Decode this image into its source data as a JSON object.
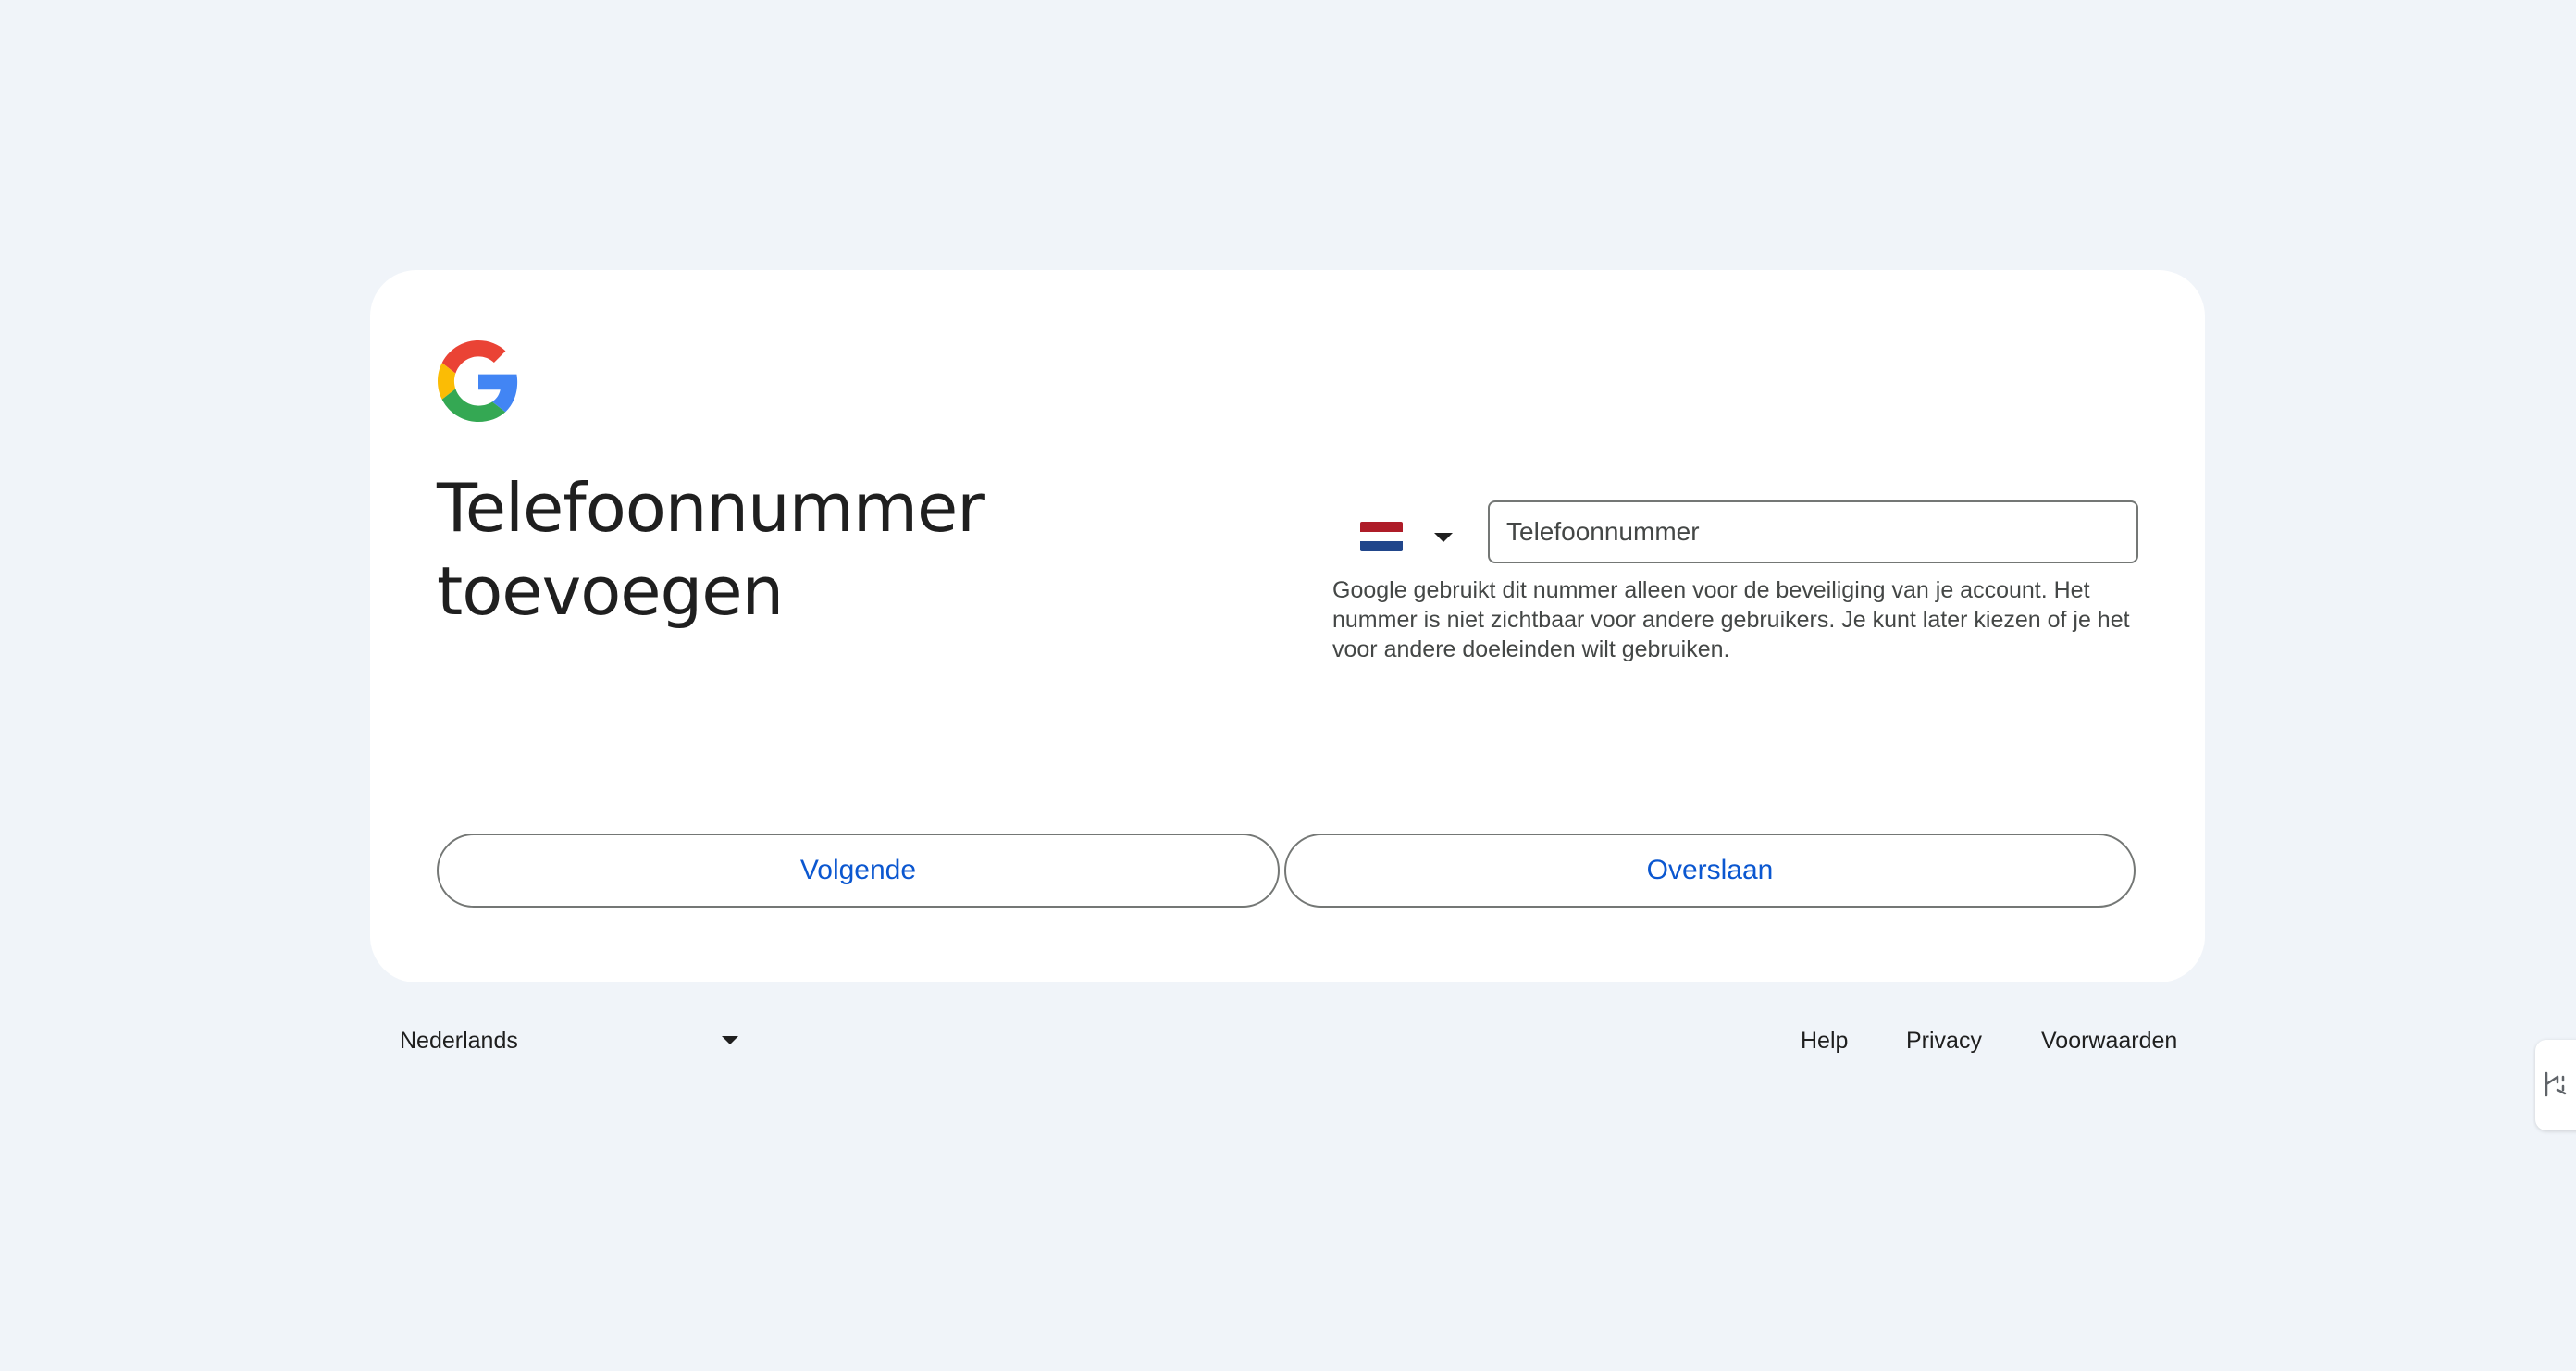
{
  "card": {
    "logo_icon": "google-g-icon",
    "title_line1": "Telefoonnummer",
    "title_line2": "toevoegen",
    "country": {
      "flag_icon": "netherlands-flag-icon",
      "dropdown_icon": "caret-down-icon"
    },
    "phone_input": {
      "placeholder": "Telefoonnummer",
      "value": ""
    },
    "help_text": "Google gebruikt dit nummer alleen voor de beveiliging van je account. Het nummer is niet zichtbaar voor andere gebruikers. Je kunt later kiezen of je het voor andere doeleinden wilt gebruiken.",
    "next_button": "Volgende",
    "skip_button": "Overslaan"
  },
  "footer": {
    "language": "Nederlands",
    "links": {
      "help": "Help",
      "privacy": "Privacy",
      "terms": "Voorwaarden"
    }
  },
  "side_tab": {
    "icon": "extension-handle-icon"
  },
  "colors": {
    "background": "#f0f4f9",
    "card": "#ffffff",
    "accent": "#0b57d0",
    "border": "#747775",
    "text": "#1f1f1f"
  }
}
